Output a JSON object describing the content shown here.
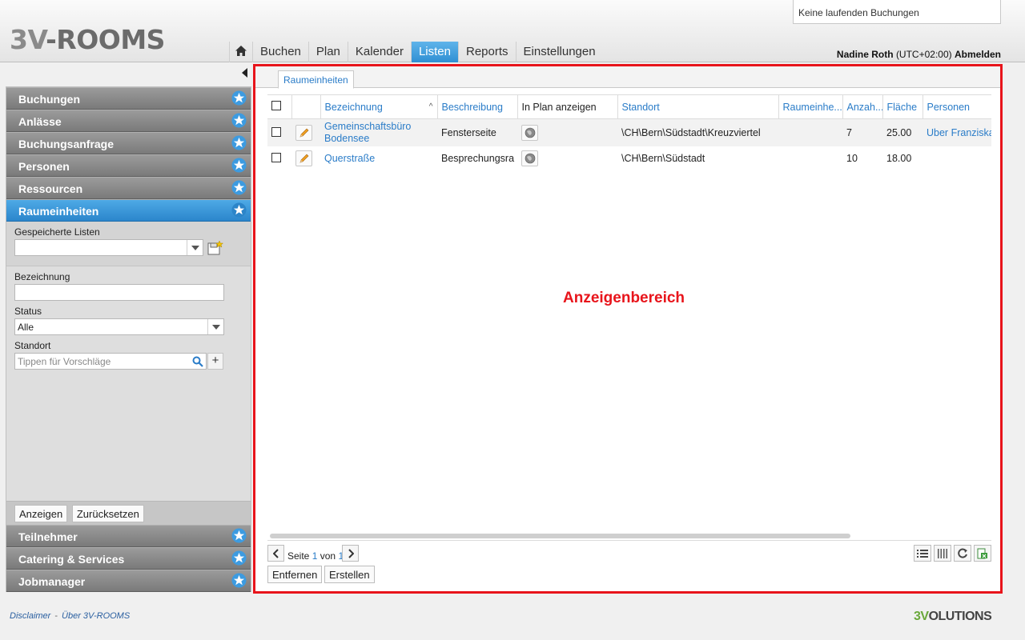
{
  "header": {
    "logo_prefix": "3V",
    "logo_suffix": "-ROOMS",
    "status_text": "Keine laufenden Buchungen",
    "nav": [
      "Buchen",
      "Plan",
      "Kalender",
      "Listen",
      "Reports",
      "Einstellungen"
    ],
    "active_nav": "Listen",
    "user_name": "Nadine Roth",
    "timezone": "(UTC+02:00)",
    "logout": "Abmelden"
  },
  "sidebar": {
    "sections_top": [
      "Buchungen",
      "Anlässe",
      "Buchungsanfrage",
      "Personen",
      "Ressourcen"
    ],
    "active_section": "Raumeinheiten",
    "saved_lists_label": "Gespeicherte Listen",
    "saved_lists_value": "",
    "filters": {
      "bezeichnung_label": "Bezeichnung",
      "bezeichnung_value": "",
      "status_label": "Status",
      "status_value": "Alle",
      "standort_label": "Standort",
      "standort_placeholder": "Tippen für Vorschläge"
    },
    "show_button": "Anzeigen",
    "reset_button": "Zurücksetzen",
    "sections_bottom": [
      "Teilnehmer",
      "Catering & Services",
      "Jobmanager"
    ]
  },
  "main": {
    "tab": "Raumeinheiten",
    "columns": {
      "bezeichnung": "Bezeichnung",
      "beschreibung": "Beschreibung",
      "in_plan": "In Plan anzeigen",
      "standort": "Standort",
      "raumeinheit": "Raumeinhe...",
      "anzahl": "Anzah...",
      "flaeche": "Fläche",
      "personen": "Personen"
    },
    "rows": [
      {
        "bezeichnung_line1": "Gemeinschaftsbüro",
        "bezeichnung_line2": "Bodensee",
        "beschreibung": "Fensterseite",
        "standort": "\\CH\\Bern\\Südstadt\\Kreuzviertel",
        "raumeinheit": "",
        "anzahl": "7",
        "flaeche": "25.00",
        "personen": "Uber Franziska"
      },
      {
        "bezeichnung_line1": "Querstraße",
        "bezeichnung_line2": "",
        "beschreibung": "Besprechungsra",
        "standort": "\\CH\\Bern\\Südstadt",
        "raumeinheit": "",
        "anzahl": "10",
        "flaeche": "18.00",
        "personen": ""
      }
    ],
    "display_label": "Anzeigenbereich",
    "pager": {
      "page_word": "Seite",
      "current": "1",
      "of_word": "von",
      "total": "1"
    },
    "remove_button": "Entfernen",
    "create_button": "Erstellen"
  },
  "footer": {
    "disclaimer": "Disclaimer",
    "separator": "-",
    "about": "Über 3V-ROOMS",
    "brand_prefix": "3V",
    "brand_suffix": "OLUTIONS"
  },
  "colors": {
    "accent_blue": "#2a7cc8",
    "highlight_red": "#e8141b",
    "active_nav_blue": "#3b98d8"
  }
}
